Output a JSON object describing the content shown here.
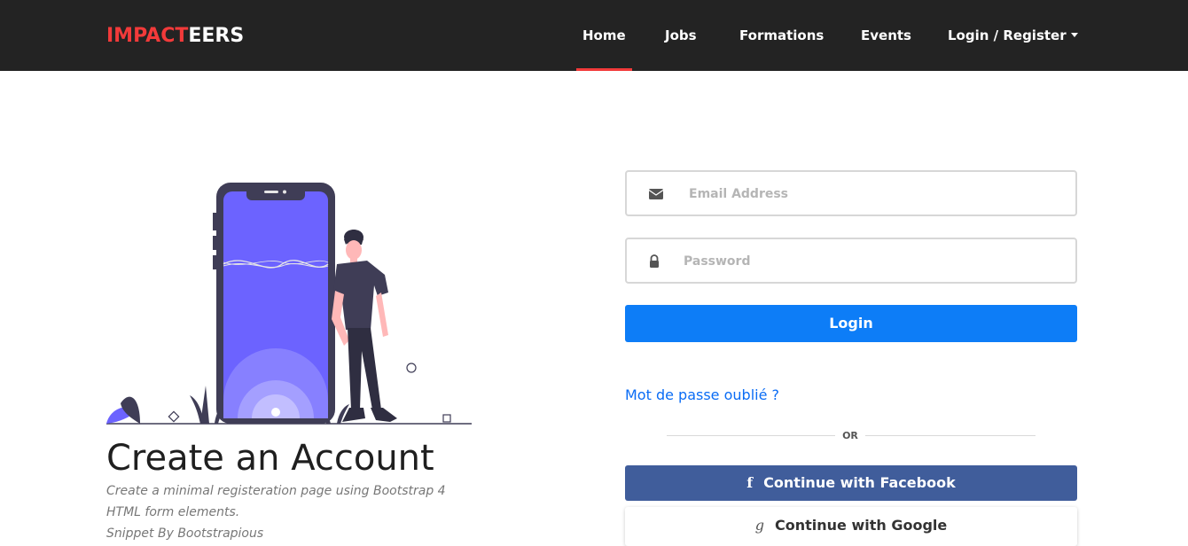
{
  "nav": {
    "brand_part1": "IMPACT",
    "brand_part2": "EERS",
    "links": [
      "Home",
      "Jobs",
      "Formations",
      "Events",
      "Login / Register"
    ],
    "active": "Home"
  },
  "hero": {
    "title": "Create an Account",
    "subtitle_lines": [
      "Create a minimal registeration page using Bootstrap 4",
      "HTML form elements.",
      "Snippet By Bootstrapious"
    ]
  },
  "form": {
    "email_placeholder": "Email Address",
    "password_placeholder": "Password",
    "login_label": "Login",
    "forgot_label": "Mot de passe oublié ?",
    "divider_label": "OR",
    "facebook_label": "Continue with Facebook",
    "google_label": "Continue with Google",
    "facebook_icon": "f",
    "google_icon": "g"
  },
  "colors": {
    "navbar": "#232323",
    "brand_accent": "#f23a3a",
    "primary_button": "#0d7df7",
    "facebook_button": "#405d9b",
    "link": "#0a6cf5"
  }
}
